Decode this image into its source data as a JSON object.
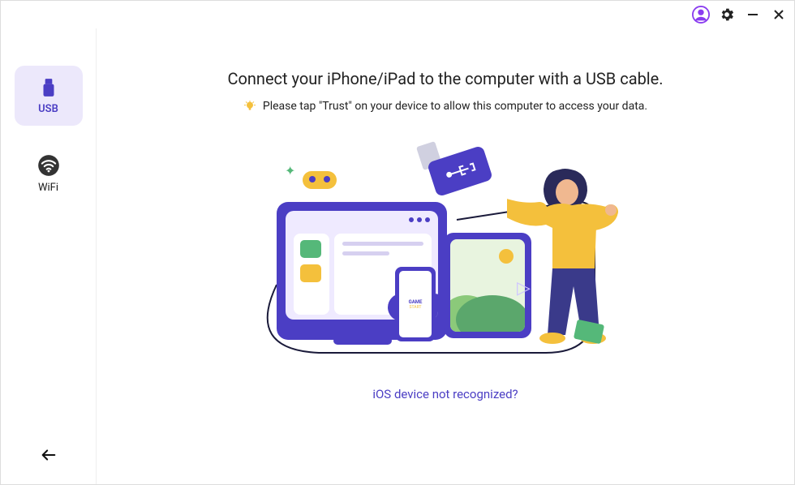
{
  "titlebar": {
    "account_icon": "account-icon",
    "settings_icon": "settings-icon",
    "minimize_icon": "minimize-icon",
    "close_icon": "close-icon"
  },
  "sidebar": {
    "items": [
      {
        "label": "USB",
        "icon": "usb-icon",
        "active": true
      },
      {
        "label": "WiFi",
        "icon": "wifi-icon",
        "active": false
      }
    ],
    "back_icon": "arrow-left-icon"
  },
  "main": {
    "heading": "Connect your iPhone/iPad to the computer with a USB cable.",
    "hint_icon": "lightbulb-icon",
    "hint_text": "Please tap \"Trust\" on your device to allow this computer to access your data.",
    "help_link": "iOS device not recognized?"
  },
  "colors": {
    "accent": "#4b3ec4",
    "accent_bg": "#ece8fb",
    "yellow": "#f4c03c",
    "green": "#55b879"
  }
}
